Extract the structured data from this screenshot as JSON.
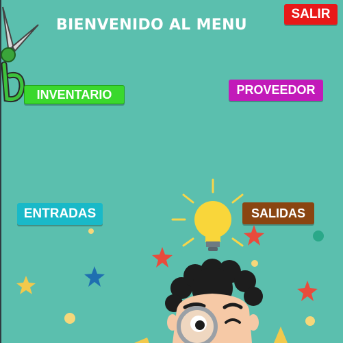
{
  "header": {
    "title": "BIENVENIDO AL MENU"
  },
  "buttons": {
    "salir": "SALIR",
    "inventario": "INVENTARIO",
    "proveedor": "PROVEEDOR",
    "entradas": "ENTRADAS",
    "salidas": "SALIDAS"
  },
  "colors": {
    "background": "#5bbfae",
    "salir": "#e81919",
    "inventario": "#3ad82d",
    "proveedor": "#c21ab9",
    "entradas": "#19b9c8",
    "salidas": "#8a4511"
  },
  "decorations": {
    "logo": "scissors-b-logo",
    "illustration": "kid-with-magnifying-glass-and-light-bulb"
  }
}
